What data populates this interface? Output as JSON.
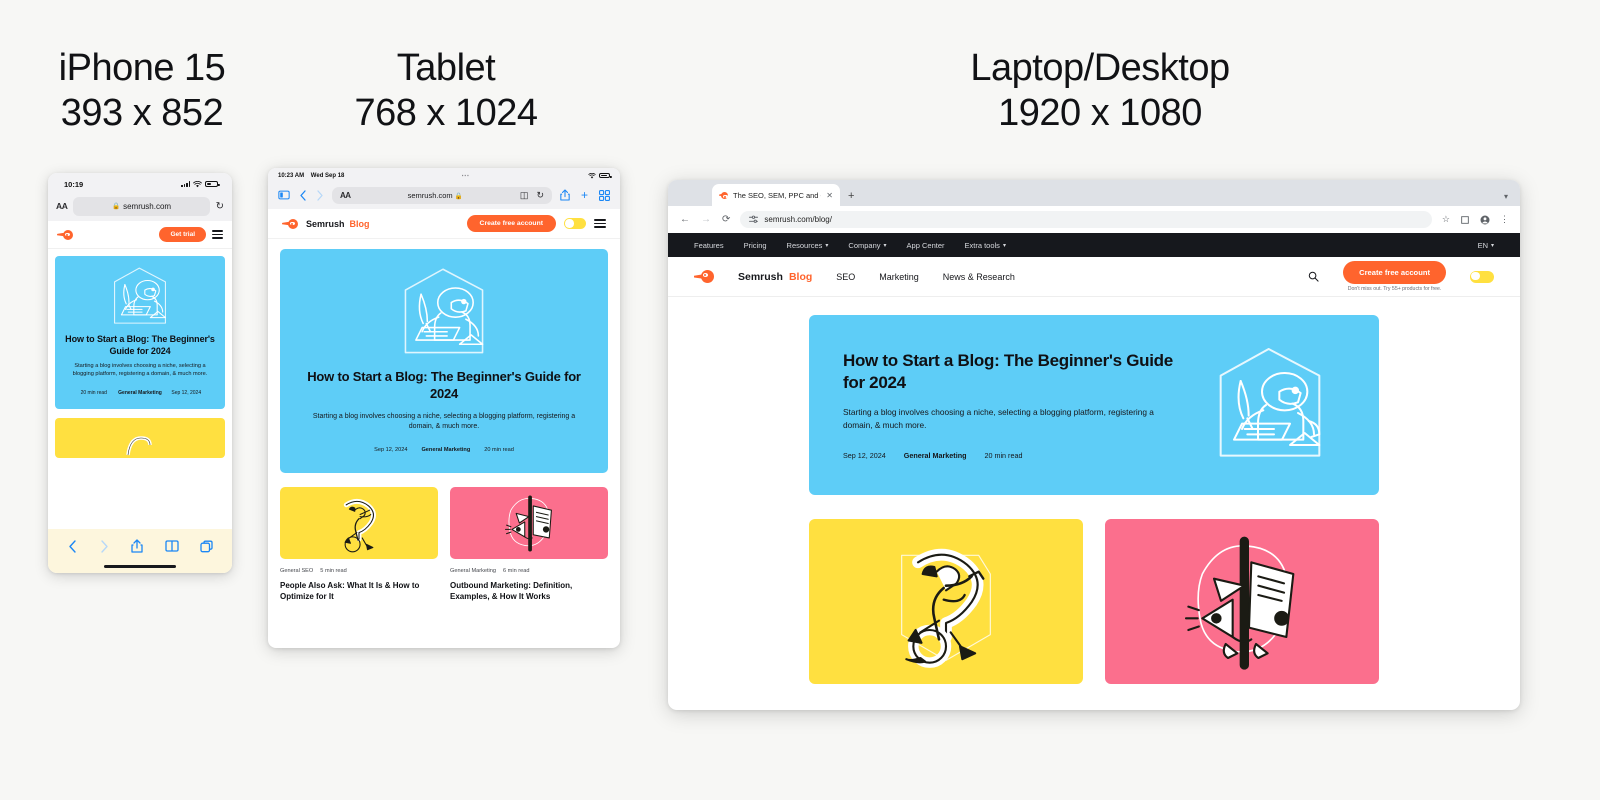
{
  "labels": [
    {
      "name": "iPhone 15",
      "size": "393 x 852"
    },
    {
      "name": "Tablet",
      "size": "768 x 1024"
    },
    {
      "name": "Laptop/Desktop",
      "size": "1920 x 1080"
    }
  ],
  "colors": {
    "page_bg": "#f7f7f5",
    "brand_orange": "#ff642d",
    "hero_blue": "#5ecdf7",
    "card_yellow": "#ffe040",
    "card_pink": "#fb6f8d",
    "nav_dark": "#16181d"
  },
  "article": {
    "title": "How to Start a Blog: The Beginner's Guide for 2024",
    "excerpt": "Starting a blog involves choosing a niche, selecting a blogging platform, registering a domain, & much more.",
    "date": "Sep 12, 2024",
    "category": "General Marketing",
    "read_time": "20 min read"
  },
  "cards": [
    {
      "category": "General SEO",
      "read_time": "5 min read",
      "title": "People Also Ask: What It Is & How to Optimize for It"
    },
    {
      "category": "General Marketing",
      "read_time": "6 min read",
      "title": "Outbound Marketing: Definition, Examples, & How It Works"
    }
  ],
  "iphone": {
    "status_time": "10:19",
    "url": "semrush.com",
    "aa_label": "AA",
    "cta": "Get trial"
  },
  "tablet": {
    "status_time": "10:23 AM",
    "status_date": "Wed Sep 18",
    "url": "semrush.com",
    "aa_label": "AA",
    "brand_name": "Semrush",
    "brand_suffix": "Blog",
    "cta": "Create free account"
  },
  "desktop": {
    "tab_title": "The SEO, SEM, PPC and Cont",
    "url": "semrush.com/blog/",
    "topnav": [
      {
        "label": "Features",
        "caret": false
      },
      {
        "label": "Pricing",
        "caret": false
      },
      {
        "label": "Resources",
        "caret": true
      },
      {
        "label": "Company",
        "caret": true
      },
      {
        "label": "App Center",
        "caret": false
      },
      {
        "label": "Extra tools",
        "caret": true
      }
    ],
    "language": "EN",
    "brand_name": "Semrush",
    "brand_suffix": "Blog",
    "blognav": [
      "SEO",
      "Marketing",
      "News & Research"
    ],
    "cta": "Create free account",
    "cta_sub": "Don't miss out. Try 55+ products for free."
  }
}
